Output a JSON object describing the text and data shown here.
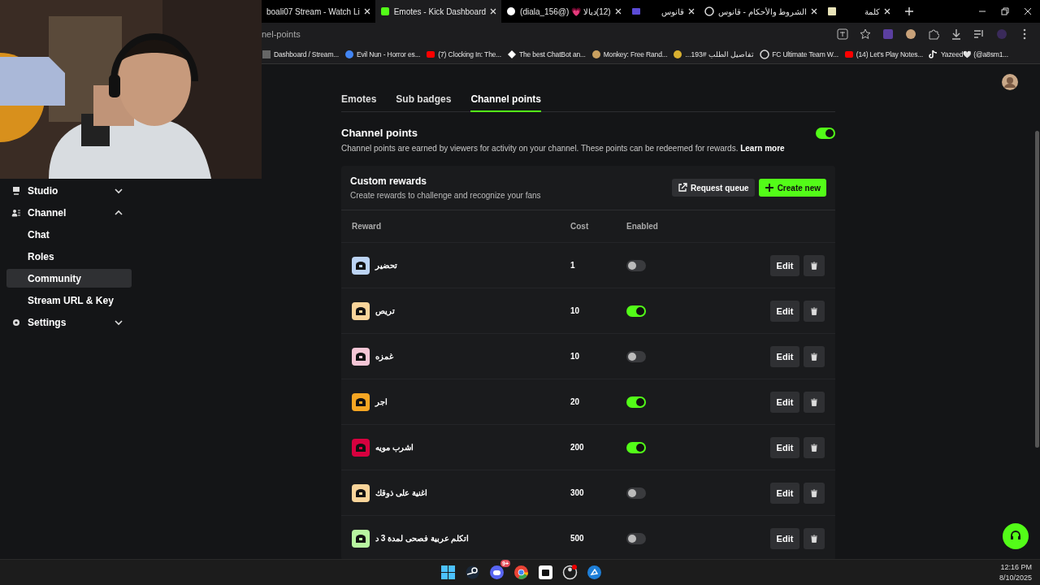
{
  "browser": {
    "tabs": [
      {
        "label": "boali07 Stream - Watch Li",
        "selected": false
      },
      {
        "label": "Emotes - Kick Dashboard",
        "selected": true
      },
      {
        "label": "(12)ديالا 💗 (@diala_156)",
        "selected": false
      },
      {
        "label": "قانوس",
        "selected": false
      },
      {
        "label": "الشروط والأحكام - قانوس",
        "selected": false
      },
      {
        "label": "كلمة",
        "selected": false
      }
    ],
    "address": "nel-points",
    "bookmarks": [
      "Dashboard / Stream...",
      "Evil Nun - Horror es...",
      "(7) Clocking In: The...",
      "The best ChatBot an...",
      "Monkey: Free Rand...",
      "تفاصيل الطلب #193...",
      "FC Ultimate Team W...",
      "(14) Let's Play Notes...",
      "Yazeed🤍 (@a8sm1..."
    ]
  },
  "sidebar": {
    "items": [
      {
        "label": "Studio",
        "expanded": false
      },
      {
        "label": "Channel",
        "expanded": true,
        "children": [
          {
            "label": "Chat",
            "selected": false
          },
          {
            "label": "Roles",
            "selected": false
          },
          {
            "label": "Community",
            "selected": true
          },
          {
            "label": "Stream URL & Key",
            "selected": false
          }
        ]
      },
      {
        "label": "Settings",
        "expanded": false
      }
    ]
  },
  "page_tabs": [
    {
      "label": "Emotes",
      "selected": false
    },
    {
      "label": "Sub badges",
      "selected": false
    },
    {
      "label": "Channel points",
      "selected": true
    }
  ],
  "channel_points": {
    "title": "Channel points",
    "enabled": true,
    "description": "Channel points are earned by viewers for activity on your channel. These points can be redeemed for rewards.",
    "link": "Learn more"
  },
  "custom_rewards": {
    "title": "Custom rewards",
    "subtitle": "Create rewards to challenge and recognize your fans",
    "buttons": [
      {
        "label": "Request queue",
        "kind": "secondary"
      },
      {
        "label": "Create new",
        "kind": "primary"
      }
    ],
    "columns": [
      "Reward",
      "Cost",
      "Enabled"
    ],
    "rows": [
      {
        "name": "تحضير",
        "cost": "1",
        "enabled": false,
        "color": "#bcd4f4",
        "edit": "Edit"
      },
      {
        "name": "تريص",
        "cost": "10",
        "enabled": true,
        "color": "#f8d49a",
        "edit": "Edit"
      },
      {
        "name": "غمزه",
        "cost": "10",
        "enabled": false,
        "color": "#f5c6d6",
        "edit": "Edit"
      },
      {
        "name": "اجر",
        "cost": "20",
        "enabled": true,
        "color": "#f5a623",
        "edit": "Edit"
      },
      {
        "name": "اشرب مويه",
        "cost": "200",
        "enabled": true,
        "color": "#d8003f",
        "edit": "Edit"
      },
      {
        "name": "اغنية على ذوقك",
        "cost": "300",
        "enabled": false,
        "color": "#f8d49a",
        "edit": "Edit"
      },
      {
        "name": "اتكلم عربية فصحى لمدة 3 د",
        "cost": "500",
        "enabled": false,
        "color": "#b8f5a0",
        "edit": "Edit"
      }
    ]
  },
  "taskbar": {
    "badge": "9+",
    "time": "12:16 PM",
    "date": "8/10/2025"
  }
}
